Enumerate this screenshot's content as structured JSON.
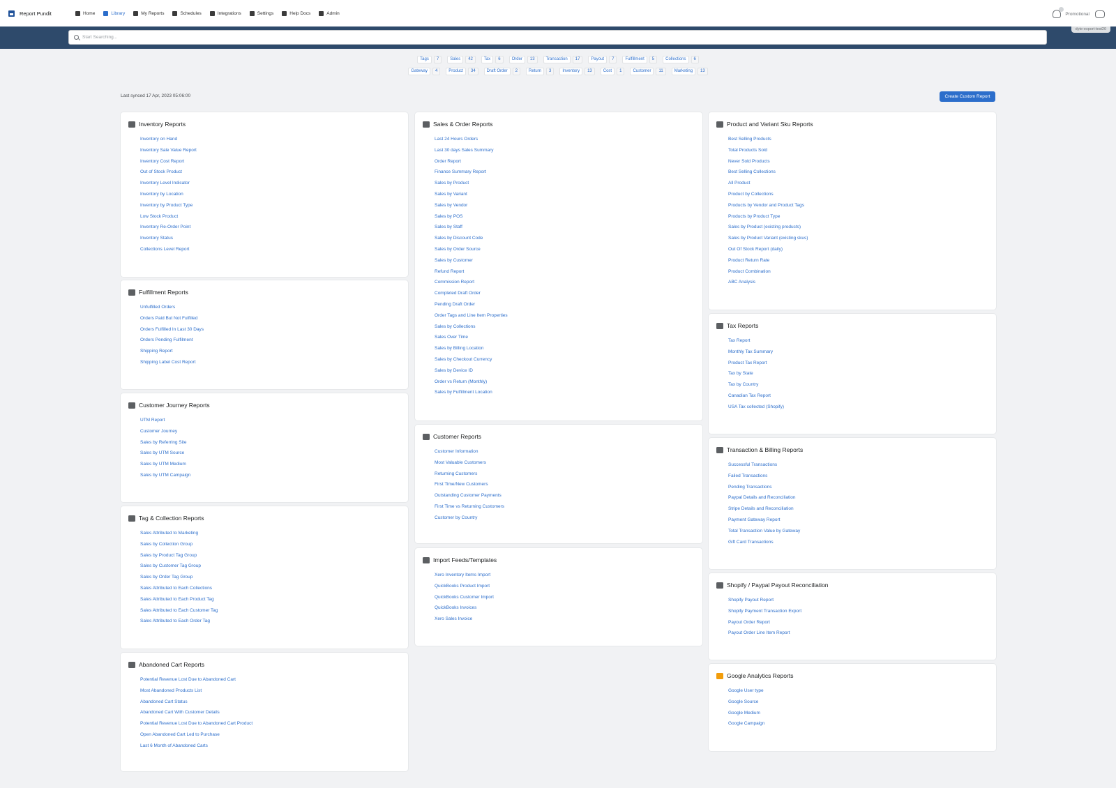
{
  "brand": {
    "name": "Report Pundit"
  },
  "nav": [
    {
      "label": "Home",
      "icon": "home-icon",
      "active": false
    },
    {
      "label": "Library",
      "icon": "library-icon",
      "active": true
    },
    {
      "label": "My Reports",
      "icon": "reports-icon",
      "active": false
    },
    {
      "label": "Schedules",
      "icon": "calendar-icon",
      "active": false
    },
    {
      "label": "Integrations",
      "icon": "integrations-icon",
      "active": false
    },
    {
      "label": "Settings",
      "icon": "gear-icon",
      "active": false
    },
    {
      "label": "Help Docs",
      "icon": "help-docs-icon",
      "active": false
    },
    {
      "label": "Admin",
      "icon": "admin-icon",
      "active": false
    }
  ],
  "header_right": {
    "plan": "Promotional",
    "notification_icon": "bell-icon",
    "chat_icon": "chat-icon"
  },
  "search": {
    "placeholder": "Start Searching...",
    "value": "",
    "store": "dyte-export-test20"
  },
  "chips": [
    [
      {
        "label": "Tags",
        "count": "7"
      },
      {
        "label": "Sales",
        "count": "42"
      },
      {
        "label": "Tax",
        "count": "6"
      },
      {
        "label": "Order",
        "count": "13"
      },
      {
        "label": "Transaction",
        "count": "17"
      },
      {
        "label": "Payout",
        "count": "7"
      },
      {
        "label": "Fulfillment",
        "count": "5"
      },
      {
        "label": "Collections",
        "count": "6"
      }
    ],
    [
      {
        "label": "Gateway",
        "count": "4"
      },
      {
        "label": "Product",
        "count": "34"
      },
      {
        "label": "Draft Order",
        "count": "2"
      },
      {
        "label": "Return",
        "count": "3"
      },
      {
        "label": "Inventory",
        "count": "13"
      },
      {
        "label": "Cost",
        "count": "1"
      },
      {
        "label": "Customer",
        "count": "11"
      },
      {
        "label": "Marketing",
        "count": "13"
      }
    ]
  ],
  "sync": {
    "text": "Last synced 17 Apr, 2023 05:06:00"
  },
  "actions": {
    "create_custom_report": "Create Custom Report"
  },
  "columns": [
    [
      {
        "title": "Inventory Reports",
        "icon": "inventory-icon",
        "items": [
          "Inventory on Hand",
          "Inventory Sale Value Report",
          "Inventory Cost Report",
          "Out of Stock Product",
          "Inventory Level Indicator",
          "Inventory by Location",
          "Inventory by Product Type",
          "Low Stock Product",
          "Inventory Re-Order Point",
          "Inventory Status",
          "Collections Level Report"
        ]
      },
      {
        "title": "Fulfillment Reports",
        "icon": "fulfillment-icon",
        "items": [
          "Unfulfilled Orders",
          "Orders Paid But Not Fulfilled",
          "Orders Fulfilled In Last 30 Days",
          "Orders Pending Fulfilment",
          "Shipping Report",
          "Shipping Label Cost Report"
        ]
      },
      {
        "title": "Customer Journey Reports",
        "icon": "customer-journey-icon",
        "items": [
          "UTM Report",
          "Customer Journey",
          "Sales by Referring Site",
          "Sales by UTM Source",
          "Sales by UTM Medium",
          "Sales by UTM Campaign"
        ]
      },
      {
        "title": "Tag & Collection Reports",
        "icon": "tag-collection-icon",
        "items": [
          "Sales Attributed to Marketing",
          "Sales by Collection Group",
          "Sales by Product Tag Group",
          "Sales by Customer Tag Group",
          "Sales by Order Tag Group",
          "Sales Attributed to Each Collections",
          "Sales Attributed to Each Product Tag",
          "Sales Attributed to Each Customer Tag",
          "Sales Attributed to Each Order Tag"
        ]
      },
      {
        "title": "Abandoned Cart Reports",
        "icon": "abandoned-cart-icon",
        "items": [
          "Potential Revenue Lost Due to Abandoned Cart",
          "Most Abandoned Products List",
          "Abandoned Cart Status",
          "Abandoned Cart With Customer Details",
          "Potential Revenue Lost Due to Abandoned Cart Product",
          "Open Abandoned Cart Led to Purchase",
          "Last 6 Month of Abandoned Carts"
        ]
      }
    ],
    [
      {
        "title": "Sales & Order Reports",
        "icon": "sales-tag-icon",
        "items": [
          "Last 24 Hours Orders",
          "Last 30 days Sales Summary",
          "Order Report",
          "Finance Summary Report",
          "Sales by Product",
          "Sales by Variant",
          "Sales by Vendor",
          "Sales by POS",
          "Sales by Staff",
          "Sales by Discount Code",
          "Sales by Order Source",
          "Sales by Customer",
          "Refund Report",
          "Commission Report",
          "Completed Draft Order",
          "Pending Draft Order",
          "Order Tags and Line Item Properties",
          "Sales by Collections",
          "Sales Over Time",
          "Sales by Billing Location",
          "Sales by Checkout Currency",
          "Sales by Device ID",
          "Order vs Return (Monthly)",
          "Sales by Fulfillment Location"
        ]
      },
      {
        "title": "Customer Reports",
        "icon": "customer-icon",
        "items": [
          "Customer Information",
          "Most Valuable Customers",
          "Returning Customers",
          "First Time/New Customers",
          "Outstanding Customer Payments",
          "First Time vs Returning Customers",
          "Customer by Country"
        ]
      },
      {
        "title": "Import Feeds/Templates",
        "icon": "import-icon",
        "items": [
          "Xero Inventory Items Import",
          "QuickBooks Product Import",
          "QuickBooks Customer Import",
          "QuickBooks Invoices",
          "Xero Sales Invoice"
        ]
      }
    ],
    [
      {
        "title": "Product and Variant Sku Reports",
        "icon": "product-icon",
        "items": [
          "Best Selling Products",
          "Total Products Sold",
          "Never Sold Products",
          "Best Selling Collections",
          "All Product",
          "Product by Collections",
          "Products by Vendor and Product Tags",
          "Products by Product Type",
          "Sales by Product (existing products)",
          "Sales by Product Variant (existing skus)",
          "Out Of Stock Report (daily)",
          "Product Return Rate",
          "Product Combination",
          "ABC Analysis"
        ]
      },
      {
        "title": "Tax Reports",
        "icon": "tax-icon",
        "items": [
          "Tax Report",
          "Monthly Tax Summary",
          "Product Tax Report",
          "Tax by State",
          "Tax by Country",
          "Canadian Tax Report",
          "USA Tax collected (Shopify)"
        ]
      },
      {
        "title": "Transaction & Billing Reports",
        "icon": "transaction-icon",
        "items": [
          "Successful Transactions",
          "Failed Transactions",
          "Pending Transactions",
          "Paypal Details and Reconciliation",
          "Stripe Details and Reconciliation",
          "Payment Gateway Report",
          "Total Transaction Value by Gateway",
          "Gift Card Transactions"
        ]
      },
      {
        "title": "Shopify / Paypal Payout Reconciliation",
        "icon": "payout-icon",
        "items": [
          "Shopify Payout Report",
          "Shopify Payment Transaction Export",
          "Payout Order Report",
          "Payout Order Line Item Report"
        ]
      },
      {
        "title": "Google Analytics Reports",
        "icon": "analytics-icon",
        "items": [
          "Google User type",
          "Google Source",
          "Google Medium",
          "Google Campaign"
        ]
      }
    ]
  ],
  "colors": {
    "accent": "#2c6ecb",
    "search_band": "#2e4a6b",
    "analytics_icon": "#f29d0b"
  }
}
